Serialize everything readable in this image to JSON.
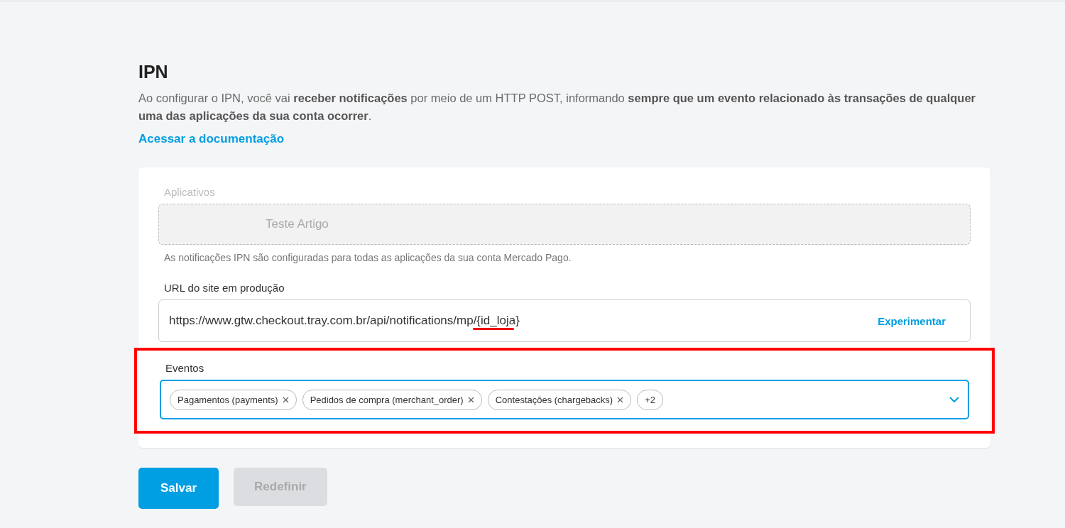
{
  "title": "IPN",
  "description": "Ao configurar o IPN, você vai **receber notificações** por meio de um HTTP POST, informando **sempre que um evento relacionado às transações de qualquer uma das aplicações da sua conta ocorrer**.",
  "doc_link": "Acessar a documentação",
  "apps": {
    "label": "Aplicativos",
    "value": "Teste Artigo",
    "disabled": true,
    "help": "As notificações IPN são configuradas para todas as aplicações da sua conta Mercado Pago."
  },
  "url": {
    "label": "URL do site em produção",
    "value": "https://www.gtw.checkout.tray.com.br/api/notifications/mp/{id_loja}",
    "action": "Experimentar",
    "underlined": true
  },
  "events": {
    "label": "Eventos",
    "focused": true,
    "highlighted": true,
    "chips": [
      {
        "label": "Pagamentos (payments)",
        "kind": "removable"
      },
      {
        "label": "Pedidos de compra (merchant_order)",
        "kind": "removable"
      },
      {
        "label": "Contestações (chargebacks)",
        "kind": "removable"
      },
      {
        "label": "+2",
        "kind": "count"
      }
    ]
  },
  "buttons": [
    {
      "label": "Salvar",
      "disabled": false
    },
    {
      "label": "Redefinir",
      "disabled": true
    }
  ]
}
